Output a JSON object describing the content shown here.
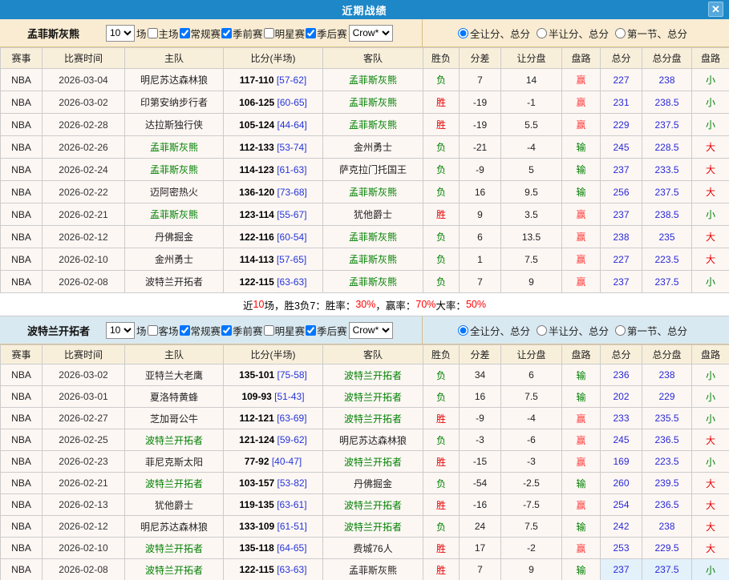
{
  "dialog": {
    "title": "近期战绩",
    "close_glyph": "✕"
  },
  "colors": {
    "titlebar_blue": "#1e87c8",
    "close_button_blue": "#55a8dc",
    "section1_bar": "#f9ecd2",
    "section2_bar": "#d9e9f1",
    "header_beige": "#f8efdb",
    "cell_tint": "#fdf7f4",
    "featured_team_green": "#008000",
    "win_red": "#e60000",
    "loss_green": "#008000",
    "cover_red": "#ff4040",
    "total_blue": "#2929d6",
    "summary_red": "#ff0000",
    "highlight_cell_blue": "#e3f1fa"
  },
  "columns": [
    "赛事",
    "比赛时间",
    "主队",
    "比分(半场)",
    "客队",
    "胜负",
    "分差",
    "让分盘",
    "盘路",
    "总分",
    "总分盘",
    "盘路"
  ],
  "sections": [
    {
      "team": "孟菲斯灰熊",
      "count_value": "10",
      "count_suffix": "场",
      "checkboxes": [
        {
          "label": "主场",
          "checked": false
        },
        {
          "label": "常规赛",
          "checked": true
        },
        {
          "label": "季前赛",
          "checked": true
        },
        {
          "label": "明星赛",
          "checked": false
        },
        {
          "label": "季后赛",
          "checked": true
        }
      ],
      "provider_value": "Crow*",
      "radios": [
        {
          "label": "全让分、总分",
          "checked": true
        },
        {
          "label": "半让分、总分",
          "checked": false
        },
        {
          "label": "第一节、总分",
          "checked": false
        }
      ],
      "rows": [
        {
          "league": "NBA",
          "date": "2026-03-04",
          "home": "明尼苏达森林狼",
          "home_featured": false,
          "score": "117-110",
          "half": "[57-62]",
          "away": "孟菲斯灰熊",
          "away_featured": true,
          "result": "负",
          "diff": "7",
          "handicap": "14",
          "handicap_result": "赢",
          "total": "227",
          "total_line": "238",
          "over_under": "小"
        },
        {
          "league": "NBA",
          "date": "2026-03-02",
          "home": "印第安纳步行者",
          "home_featured": false,
          "score": "106-125",
          "half": "[60-65]",
          "away": "孟菲斯灰熊",
          "away_featured": true,
          "result": "胜",
          "diff": "-19",
          "handicap": "-1",
          "handicap_result": "赢",
          "total": "231",
          "total_line": "238.5",
          "over_under": "小"
        },
        {
          "league": "NBA",
          "date": "2026-02-28",
          "home": "达拉斯独行侠",
          "home_featured": false,
          "score": "105-124",
          "half": "[44-64]",
          "away": "孟菲斯灰熊",
          "away_featured": true,
          "result": "胜",
          "diff": "-19",
          "handicap": "5.5",
          "handicap_result": "赢",
          "total": "229",
          "total_line": "237.5",
          "over_under": "小"
        },
        {
          "league": "NBA",
          "date": "2026-02-26",
          "home": "孟菲斯灰熊",
          "home_featured": true,
          "score": "112-133",
          "half": "[53-74]",
          "away": "金州勇士",
          "away_featured": false,
          "result": "负",
          "diff": "-21",
          "handicap": "-4",
          "handicap_result": "输",
          "total": "245",
          "total_line": "228.5",
          "over_under": "大"
        },
        {
          "league": "NBA",
          "date": "2026-02-24",
          "home": "孟菲斯灰熊",
          "home_featured": true,
          "score": "114-123",
          "half": "[61-63]",
          "away": "萨克拉门托国王",
          "away_featured": false,
          "result": "负",
          "diff": "-9",
          "handicap": "5",
          "handicap_result": "输",
          "total": "237",
          "total_line": "233.5",
          "over_under": "大"
        },
        {
          "league": "NBA",
          "date": "2026-02-22",
          "home": "迈阿密热火",
          "home_featured": false,
          "score": "136-120",
          "half": "[73-68]",
          "away": "孟菲斯灰熊",
          "away_featured": true,
          "result": "负",
          "diff": "16",
          "handicap": "9.5",
          "handicap_result": "输",
          "total": "256",
          "total_line": "237.5",
          "over_under": "大"
        },
        {
          "league": "NBA",
          "date": "2026-02-21",
          "home": "孟菲斯灰熊",
          "home_featured": true,
          "score": "123-114",
          "half": "[55-67]",
          "away": "犹他爵士",
          "away_featured": false,
          "result": "胜",
          "diff": "9",
          "handicap": "3.5",
          "handicap_result": "赢",
          "total": "237",
          "total_line": "238.5",
          "over_under": "小"
        },
        {
          "league": "NBA",
          "date": "2026-02-12",
          "home": "丹佛掘金",
          "home_featured": false,
          "score": "122-116",
          "half": "[60-54]",
          "away": "孟菲斯灰熊",
          "away_featured": true,
          "result": "负",
          "diff": "6",
          "handicap": "13.5",
          "handicap_result": "赢",
          "total": "238",
          "total_line": "235",
          "over_under": "大"
        },
        {
          "league": "NBA",
          "date": "2026-02-10",
          "home": "金州勇士",
          "home_featured": false,
          "score": "114-113",
          "half": "[57-65]",
          "away": "孟菲斯灰熊",
          "away_featured": true,
          "result": "负",
          "diff": "1",
          "handicap": "7.5",
          "handicap_result": "赢",
          "total": "227",
          "total_line": "223.5",
          "over_under": "大"
        },
        {
          "league": "NBA",
          "date": "2026-02-08",
          "home": "波特兰开拓者",
          "home_featured": false,
          "score": "122-115",
          "half": "[63-63]",
          "away": "孟菲斯灰熊",
          "away_featured": true,
          "result": "负",
          "diff": "7",
          "handicap": "9",
          "handicap_result": "赢",
          "total": "237",
          "total_line": "237.5",
          "over_under": "小"
        }
      ],
      "summary": [
        {
          "text": "近 ",
          "color": "dark"
        },
        {
          "text": "10",
          "color": "red"
        },
        {
          "text": " 场，胜3负7：胜率：",
          "color": "dark"
        },
        {
          "text": "30%",
          "color": "red"
        },
        {
          "text": "，赢率：",
          "color": "dark"
        },
        {
          "text": "70%",
          "color": "red"
        },
        {
          "text": " 大率：",
          "color": "dark"
        },
        {
          "text": "50%",
          "color": "red"
        }
      ]
    },
    {
      "team": "波特兰开拓者",
      "count_value": "10",
      "count_suffix": "场",
      "checkboxes": [
        {
          "label": "客场",
          "checked": false
        },
        {
          "label": "常规赛",
          "checked": true
        },
        {
          "label": "季前赛",
          "checked": true
        },
        {
          "label": "明星赛",
          "checked": false
        },
        {
          "label": "季后赛",
          "checked": true
        }
      ],
      "provider_value": "Crow*",
      "radios": [
        {
          "label": "全让分、总分",
          "checked": true
        },
        {
          "label": "半让分、总分",
          "checked": false
        },
        {
          "label": "第一节、总分",
          "checked": false
        }
      ],
      "rows": [
        {
          "league": "NBA",
          "date": "2026-03-02",
          "home": "亚特兰大老鹰",
          "home_featured": false,
          "score": "135-101",
          "half": "[75-58]",
          "away": "波特兰开拓者",
          "away_featured": true,
          "result": "负",
          "diff": "34",
          "handicap": "6",
          "handicap_result": "输",
          "total": "236",
          "total_line": "238",
          "over_under": "小"
        },
        {
          "league": "NBA",
          "date": "2026-03-01",
          "home": "夏洛特黄蜂",
          "home_featured": false,
          "score": "109-93",
          "half": "[51-43]",
          "away": "波特兰开拓者",
          "away_featured": true,
          "result": "负",
          "diff": "16",
          "handicap": "7.5",
          "handicap_result": "输",
          "total": "202",
          "total_line": "229",
          "over_under": "小"
        },
        {
          "league": "NBA",
          "date": "2026-02-27",
          "home": "芝加哥公牛",
          "home_featured": false,
          "score": "112-121",
          "half": "[63-69]",
          "away": "波特兰开拓者",
          "away_featured": true,
          "result": "胜",
          "diff": "-9",
          "handicap": "-4",
          "handicap_result": "赢",
          "total": "233",
          "total_line": "235.5",
          "over_under": "小"
        },
        {
          "league": "NBA",
          "date": "2026-02-25",
          "home": "波特兰开拓者",
          "home_featured": true,
          "score": "121-124",
          "half": "[59-62]",
          "away": "明尼苏达森林狼",
          "away_featured": false,
          "result": "负",
          "diff": "-3",
          "handicap": "-6",
          "handicap_result": "赢",
          "total": "245",
          "total_line": "236.5",
          "over_under": "大"
        },
        {
          "league": "NBA",
          "date": "2026-02-23",
          "home": "菲尼克斯太阳",
          "home_featured": false,
          "score": "77-92",
          "half": "[40-47]",
          "away": "波特兰开拓者",
          "away_featured": true,
          "result": "胜",
          "diff": "-15",
          "handicap": "-3",
          "handicap_result": "赢",
          "total": "169",
          "total_line": "223.5",
          "over_under": "小"
        },
        {
          "league": "NBA",
          "date": "2026-02-21",
          "home": "波特兰开拓者",
          "home_featured": true,
          "score": "103-157",
          "half": "[53-82]",
          "away": "丹佛掘金",
          "away_featured": false,
          "result": "负",
          "diff": "-54",
          "handicap": "-2.5",
          "handicap_result": "输",
          "total": "260",
          "total_line": "239.5",
          "over_under": "大"
        },
        {
          "league": "NBA",
          "date": "2026-02-13",
          "home": "犹他爵士",
          "home_featured": false,
          "score": "119-135",
          "half": "[63-61]",
          "away": "波特兰开拓者",
          "away_featured": true,
          "result": "胜",
          "diff": "-16",
          "handicap": "-7.5",
          "handicap_result": "赢",
          "total": "254",
          "total_line": "236.5",
          "over_under": "大"
        },
        {
          "league": "NBA",
          "date": "2026-02-12",
          "home": "明尼苏达森林狼",
          "home_featured": false,
          "score": "133-109",
          "half": "[61-51]",
          "away": "波特兰开拓者",
          "away_featured": true,
          "result": "负",
          "diff": "24",
          "handicap": "7.5",
          "handicap_result": "输",
          "total": "242",
          "total_line": "238",
          "over_under": "大"
        },
        {
          "league": "NBA",
          "date": "2026-02-10",
          "home": "波特兰开拓者",
          "home_featured": true,
          "score": "135-118",
          "half": "[64-65]",
          "away": "费城76人",
          "away_featured": false,
          "result": "胜",
          "diff": "17",
          "handicap": "-2",
          "handicap_result": "赢",
          "total": "253",
          "total_line": "229.5",
          "over_under": "大"
        },
        {
          "league": "NBA",
          "date": "2026-02-08",
          "home": "波特兰开拓者",
          "home_featured": true,
          "score": "122-115",
          "half": "[63-63]",
          "away": "孟菲斯灰熊",
          "away_featured": false,
          "result": "胜",
          "diff": "7",
          "handicap": "9",
          "handicap_result": "输",
          "total": "237",
          "total_line": "237.5",
          "over_under": "小",
          "highlight": true
        }
      ]
    }
  ]
}
